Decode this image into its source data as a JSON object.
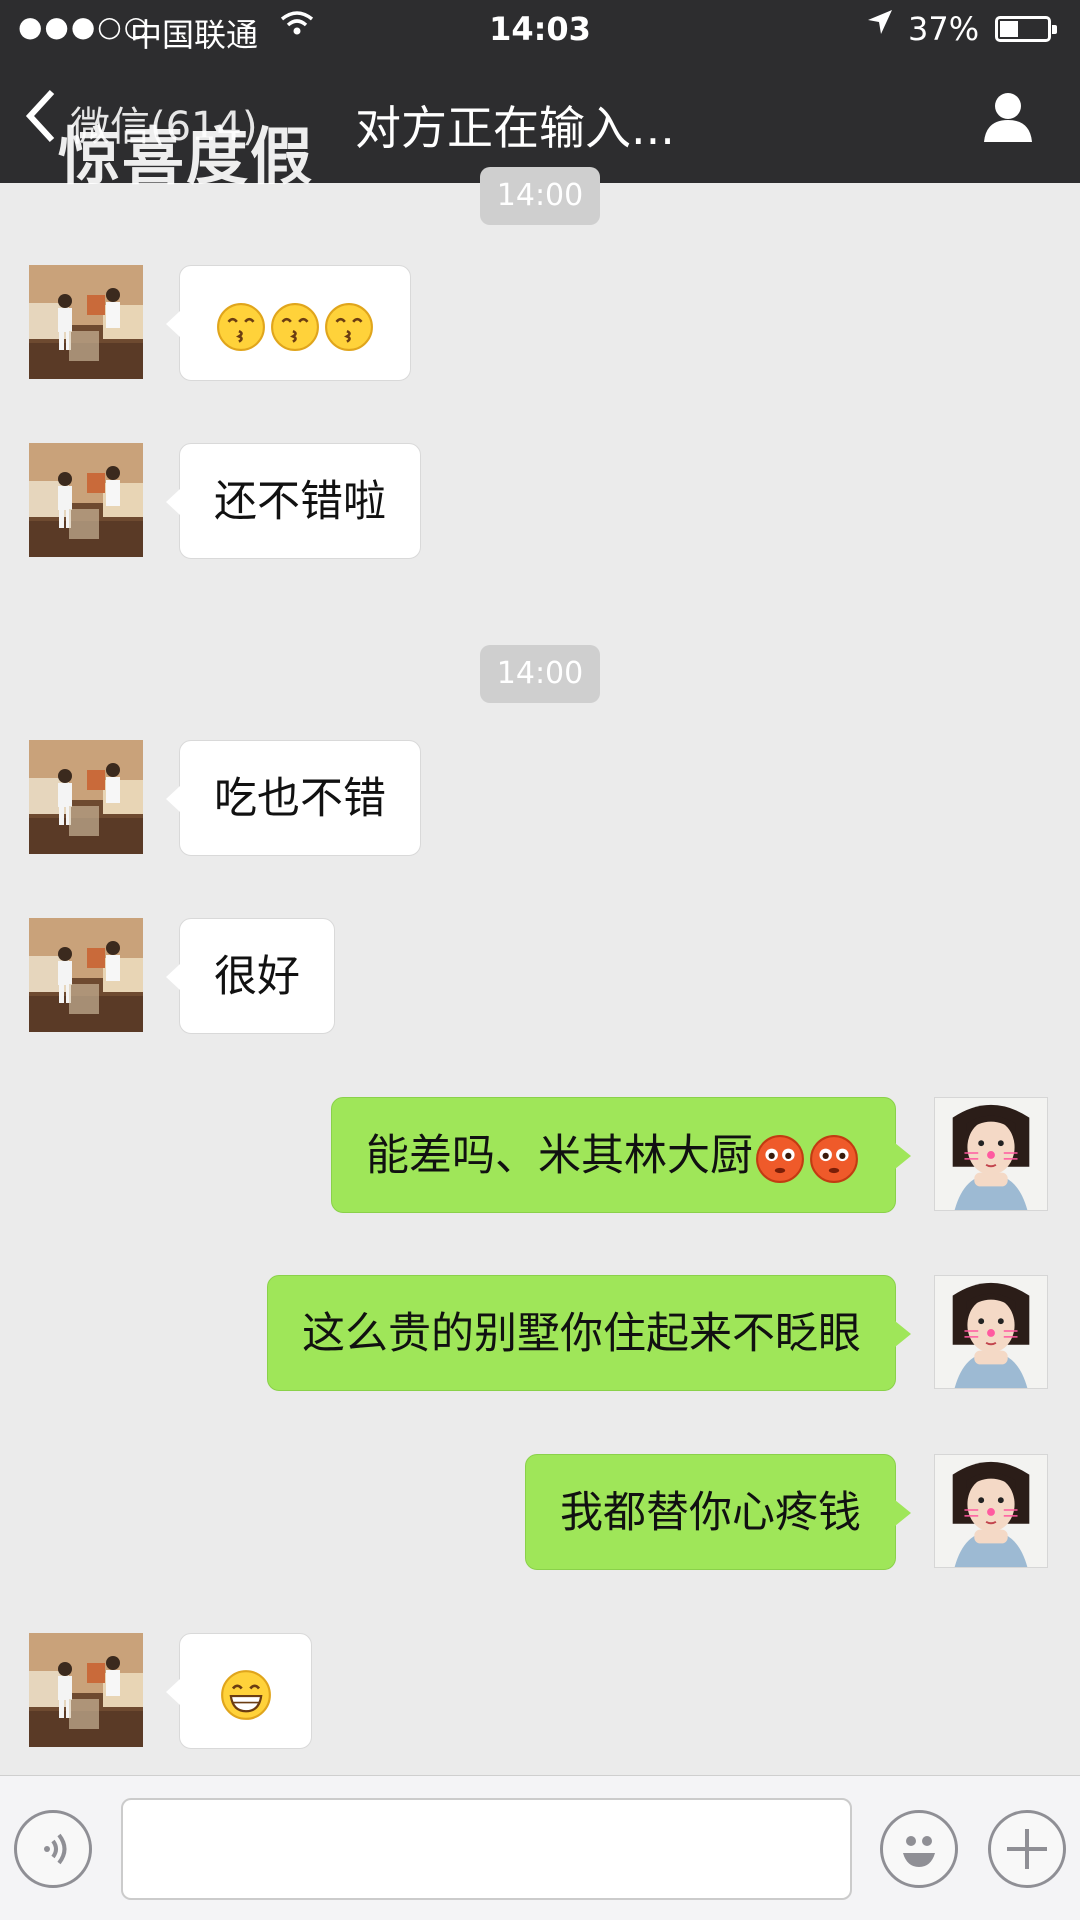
{
  "status_bar": {
    "signal": "●●●○○",
    "carrier": "中国联通",
    "time": "14:03",
    "battery_percent": "37%",
    "battery_level": 0.37
  },
  "nav": {
    "back_label": "微信(614)",
    "watermark": "惊喜度假",
    "title": "对方正在输入..."
  },
  "messages": {
    "ts1": "14:00",
    "m1": {
      "side": "in",
      "emojis": [
        "kissing-face",
        "kissing-face",
        "kissing-face"
      ]
    },
    "m2": {
      "side": "in",
      "text": "还不错啦"
    },
    "ts2": "14:00",
    "m3": {
      "side": "in",
      "text": "吃也不错"
    },
    "m4": {
      "side": "in",
      "text": "很好"
    },
    "m5": {
      "side": "out",
      "text": "能差吗、米其林大厨",
      "emojis": [
        "flushed-face",
        "flushed-face"
      ]
    },
    "m6": {
      "side": "out",
      "text": "这么贵的别墅你住起来不眨眼"
    },
    "m7": {
      "side": "out",
      "text": "我都替你心疼钱"
    },
    "m8": {
      "side": "in",
      "emojis": [
        "grinning-face"
      ]
    }
  },
  "input_bar": {
    "text_value": ""
  },
  "colors": {
    "outgoing_bubble": "#9fe659",
    "incoming_bubble": "#ffffff",
    "background": "#ebebeb",
    "topbar": "#2d2d2f"
  }
}
